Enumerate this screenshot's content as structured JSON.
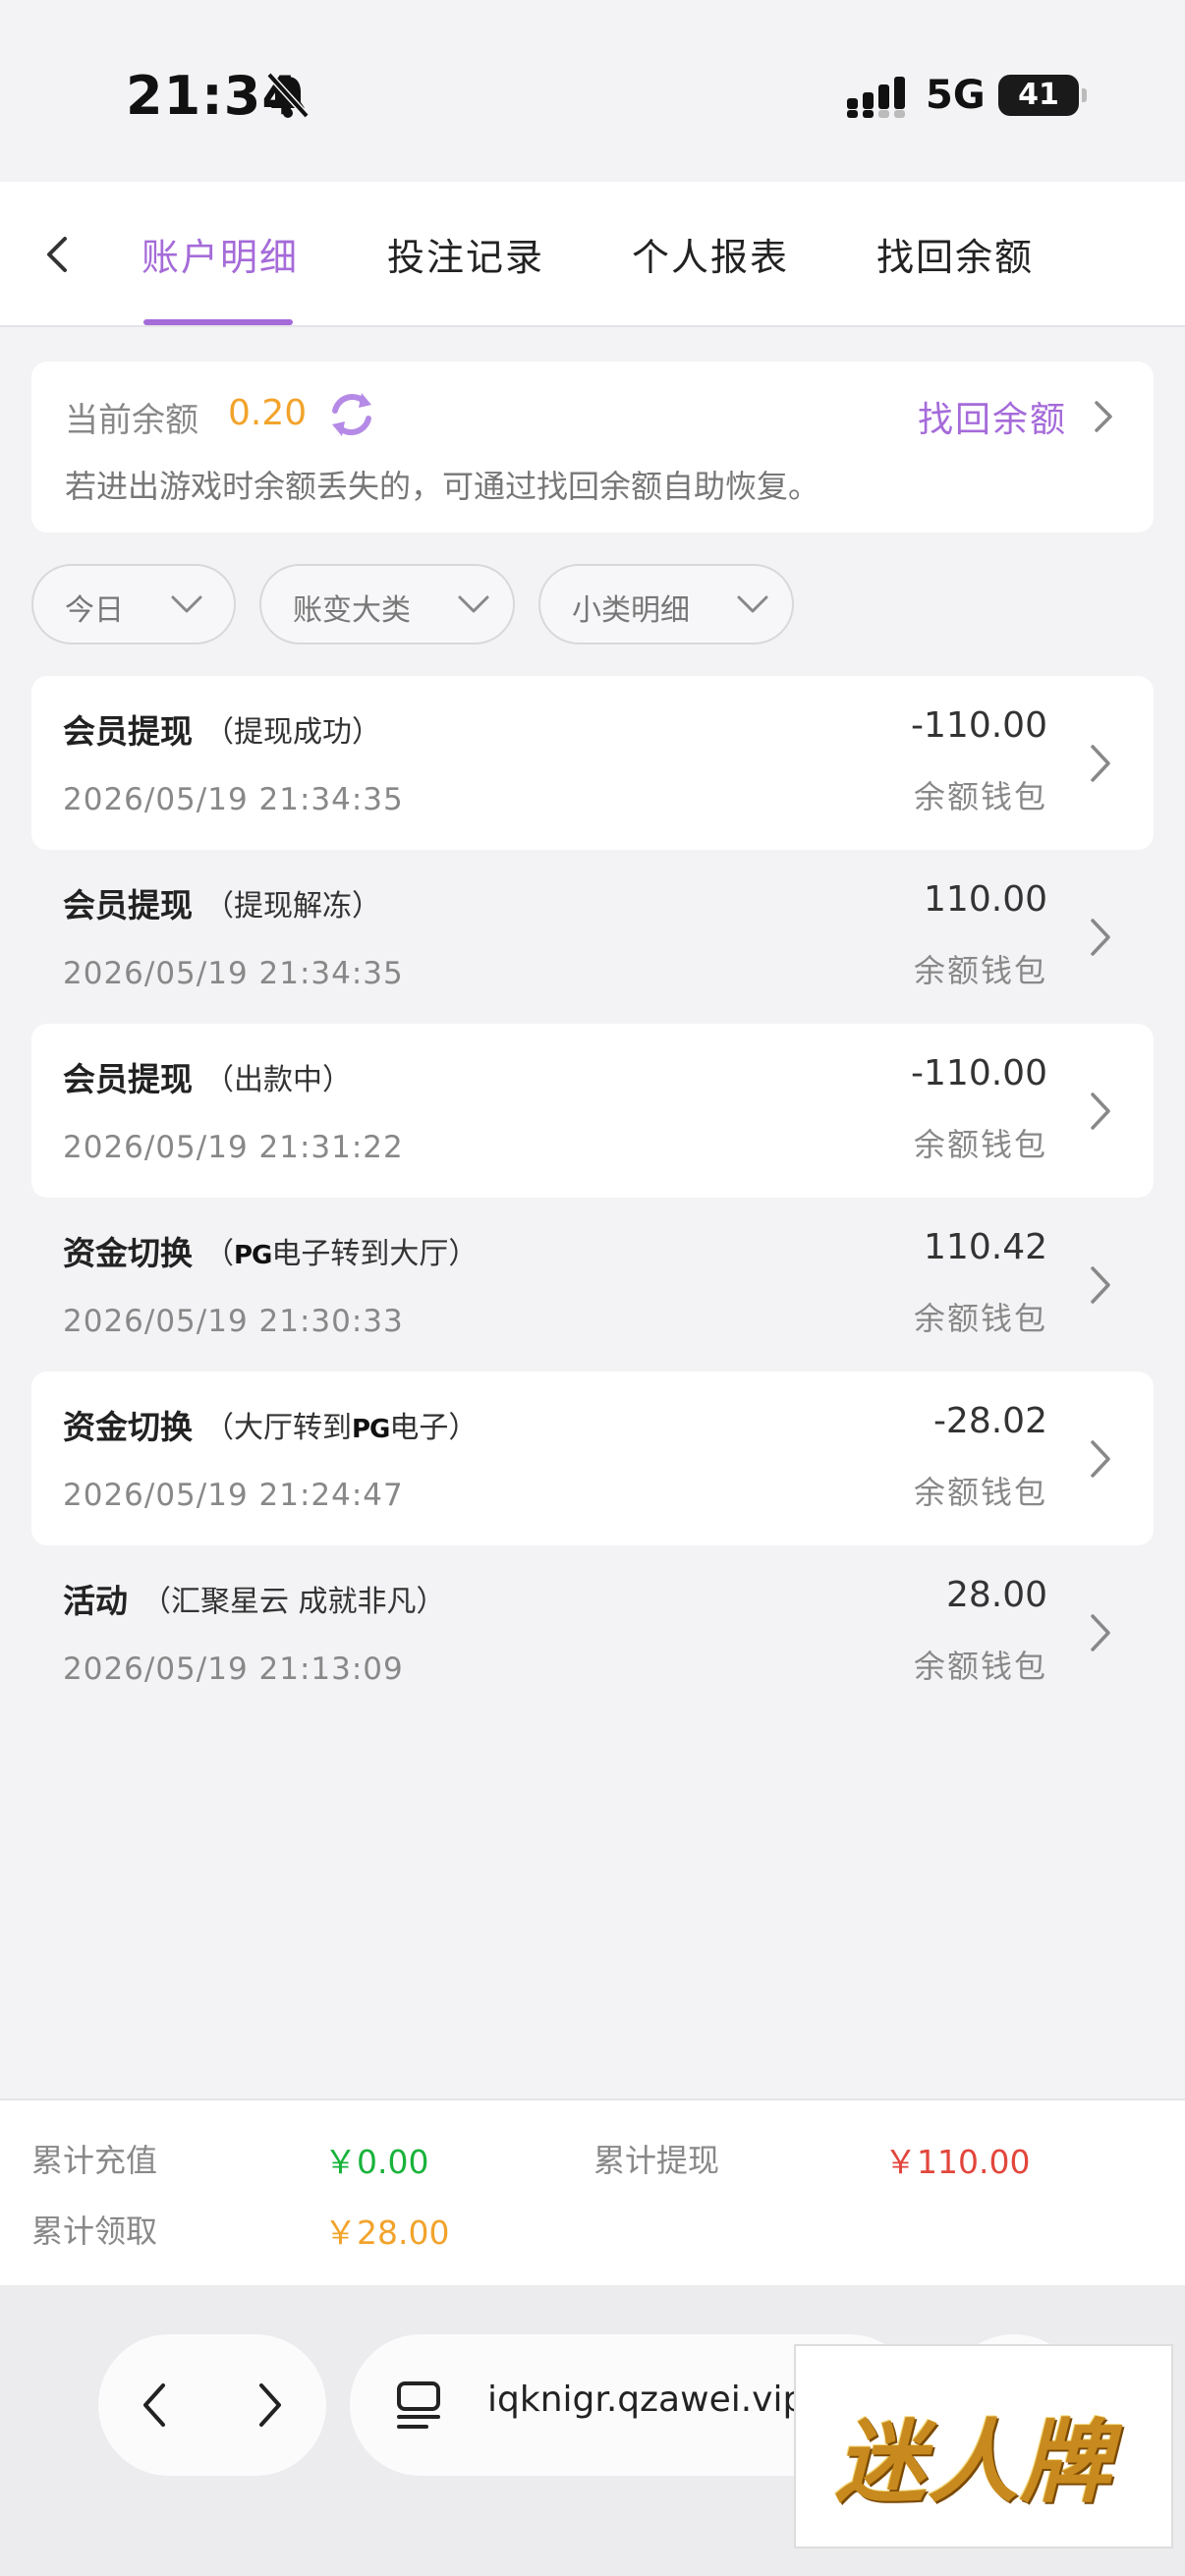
{
  "status_bar": {
    "time": "21:34",
    "network": "5G",
    "battery": "41"
  },
  "tabs": [
    {
      "label": "账户明细",
      "active": true
    },
    {
      "label": "投注记录",
      "active": false
    },
    {
      "label": "个人报表",
      "active": false
    },
    {
      "label": "找回余额",
      "active": false
    }
  ],
  "balance": {
    "label": "当前余额",
    "value": "0.20",
    "recover_link": "找回余额",
    "hint": "若进出游戏时余额丢失的，可通过找回余额自助恢复。"
  },
  "filters": [
    {
      "label": "今日"
    },
    {
      "label": "账变大类"
    },
    {
      "label": "小类明细"
    }
  ],
  "records": [
    {
      "title": "会员提现",
      "detail": "（提现成功）",
      "date": "2026/05/19 21:34:35",
      "amount": "-110.00",
      "wallet": "余额钱包"
    },
    {
      "title": "会员提现",
      "detail": "（提现解冻）",
      "date": "2026/05/19 21:34:35",
      "amount": "110.00",
      "wallet": "余额钱包"
    },
    {
      "title": "会员提现",
      "detail": "（出款中）",
      "date": "2026/05/19 21:31:22",
      "amount": "-110.00",
      "wallet": "余额钱包"
    },
    {
      "title": "资金切换",
      "detail_pre": "（",
      "detail_brand": "PG",
      "detail_post": "电子转到大厅）",
      "date": "2026/05/19 21:30:33",
      "amount": "110.42",
      "wallet": "余额钱包"
    },
    {
      "title": "资金切换",
      "detail_pre": "（大厅转到",
      "detail_brand": "PG",
      "detail_post": "电子）",
      "date": "2026/05/19 21:24:47",
      "amount": "-28.02",
      "wallet": "余额钱包"
    },
    {
      "title": "活动",
      "detail": "（汇聚星云 成就非凡）",
      "date": "2026/05/19 21:13:09",
      "amount": "28.00",
      "wallet": "余额钱包"
    }
  ],
  "summary": {
    "recharge_label": "累计充值",
    "recharge_value": "￥0.00",
    "withdraw_label": "累计提现",
    "withdraw_value": "￥110.00",
    "claim_label": "累计领取",
    "claim_value": "￥28.00"
  },
  "browser": {
    "url": "iqknigr.qzawei.vip"
  },
  "watermark": {
    "logo_text": "迷人牌"
  },
  "colors": {
    "accent": "#a56bd9",
    "balance": "#f2a32c",
    "recharge": "#19b33b",
    "withdraw": "#e2463c",
    "claim": "#f2a32c"
  }
}
